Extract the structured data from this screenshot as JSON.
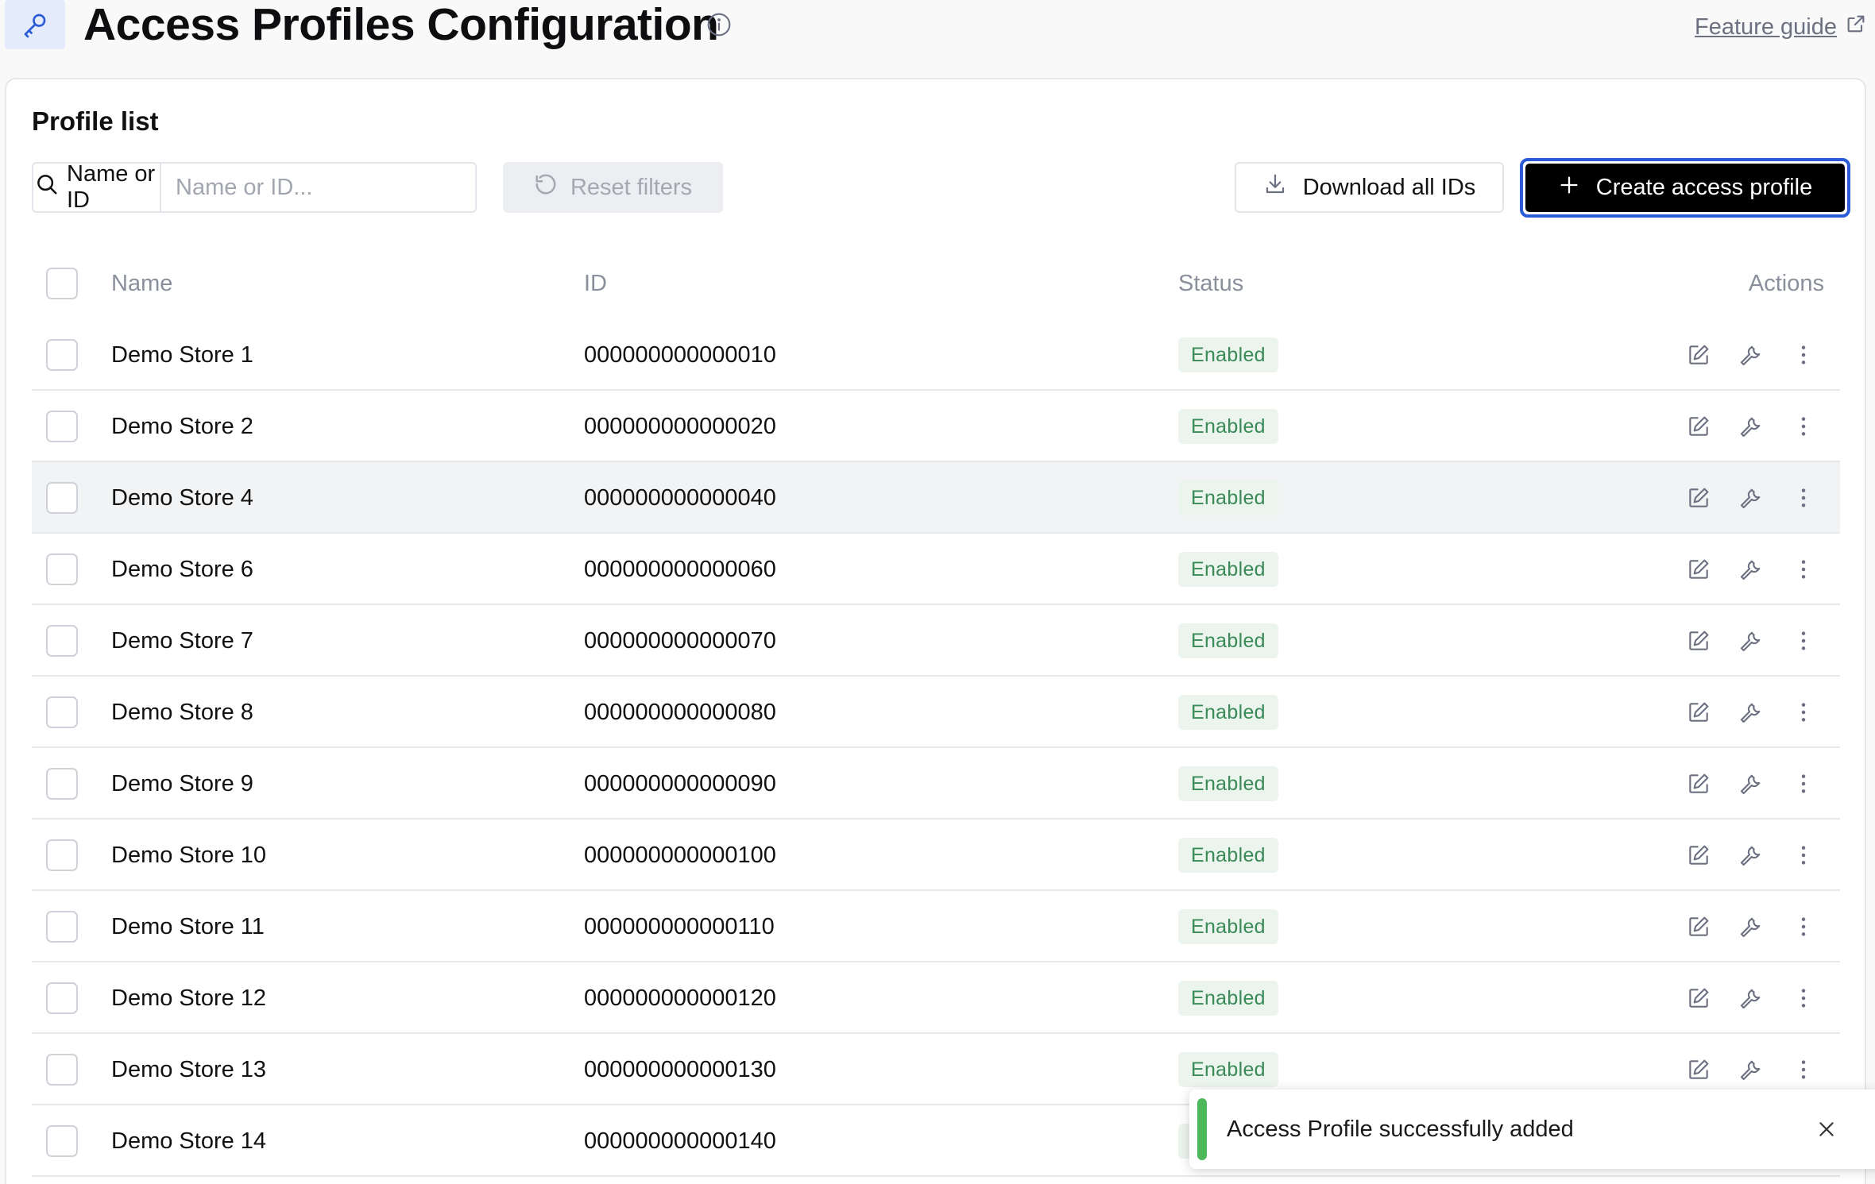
{
  "header": {
    "title": "Access Profiles Configuration",
    "feature_guide": "Feature guide"
  },
  "card": {
    "title": "Profile list"
  },
  "toolbar": {
    "search_label": "Name or ID",
    "search_placeholder": "Name or ID...",
    "search_value": "",
    "reset_label": "Reset filters",
    "download_label": "Download all IDs",
    "create_label": "Create access profile"
  },
  "table": {
    "columns": {
      "name": "Name",
      "id": "ID",
      "status": "Status",
      "actions": "Actions"
    },
    "rows": [
      {
        "name": "Demo Store 1",
        "id": "000000000000010",
        "status": "Enabled"
      },
      {
        "name": "Demo Store 2",
        "id": "000000000000020",
        "status": "Enabled"
      },
      {
        "name": "Demo Store 4",
        "id": "000000000000040",
        "status": "Enabled"
      },
      {
        "name": "Demo Store 6",
        "id": "000000000000060",
        "status": "Enabled"
      },
      {
        "name": "Demo Store 7",
        "id": "000000000000070",
        "status": "Enabled"
      },
      {
        "name": "Demo Store 8",
        "id": "000000000000080",
        "status": "Enabled"
      },
      {
        "name": "Demo Store 9",
        "id": "000000000000090",
        "status": "Enabled"
      },
      {
        "name": "Demo Store 10",
        "id": "000000000000100",
        "status": "Enabled"
      },
      {
        "name": "Demo Store 11",
        "id": "000000000000110",
        "status": "Enabled"
      },
      {
        "name": "Demo Store 12",
        "id": "000000000000120",
        "status": "Enabled"
      },
      {
        "name": "Demo Store 13",
        "id": "000000000000130",
        "status": "Enabled"
      },
      {
        "name": "Demo Store 14",
        "id": "000000000000140",
        "status": "Enabled"
      }
    ]
  },
  "toast": {
    "message": "Access Profile successfully added"
  },
  "icons": {
    "header": "key-icon",
    "title_info": "info-icon",
    "feature_guide": "external-link-icon",
    "search": "search-icon",
    "reset": "refresh-icon",
    "download": "download-icon",
    "create": "plus-icon",
    "row_actions": [
      "edit-icon",
      "wrench-icon",
      "more-vertical-icon"
    ],
    "toast_close": "close-icon"
  },
  "colors": {
    "accent": "#2b5bd7",
    "primary_button": "#000000",
    "enabled_badge_bg": "#ebf5ee",
    "enabled_badge_text": "#3a8a57",
    "toast_success": "#4cb85a"
  }
}
